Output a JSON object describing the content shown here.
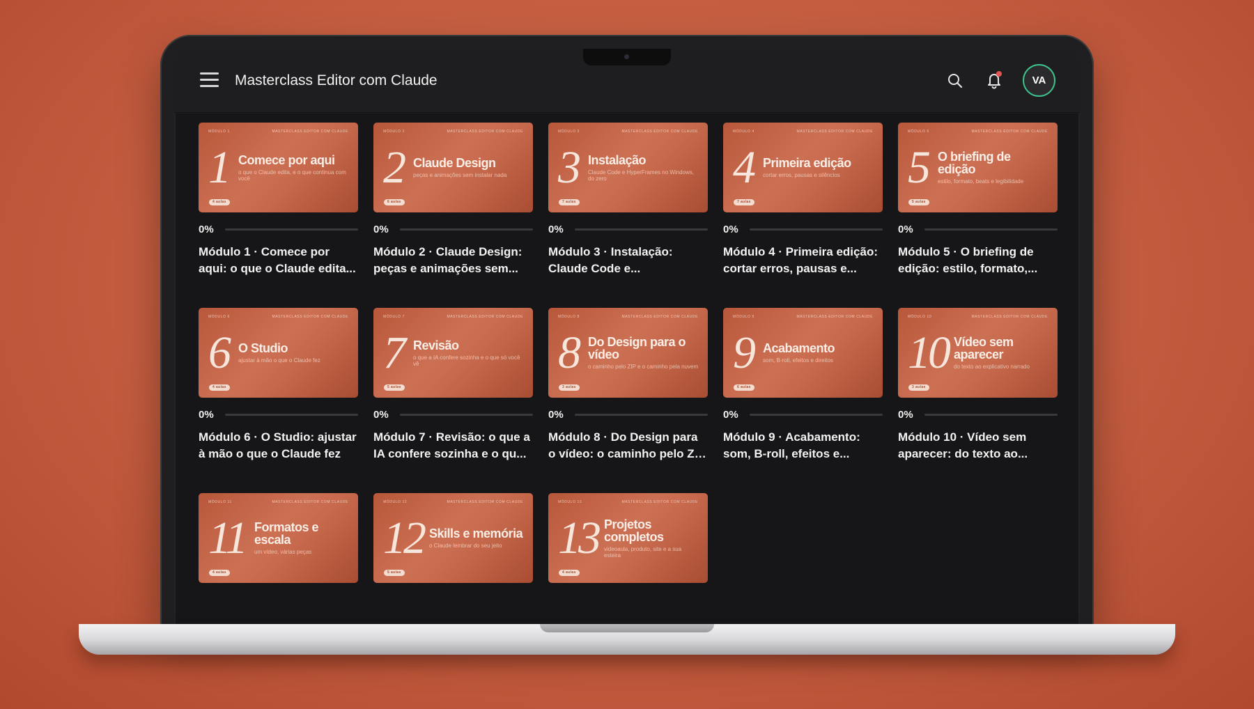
{
  "header": {
    "title": "Masterclass Editor com Claude",
    "avatar_initials": "VA",
    "icons": {
      "menu": "hamburger-icon",
      "search": "search-icon",
      "notifications": "bell-icon"
    },
    "has_unread_notifications": true
  },
  "colors": {
    "accent": "#3ec48f",
    "thumbnail": "#c4633f",
    "notification_dot": "#e55353"
  },
  "modules": [
    {
      "num": "1",
      "kicker": "Módulo 1",
      "brand": "Masterclass Editor com Claude",
      "thumb_title": "Comece por aqui",
      "thumb_sub": "o que o Claude edita, e o que continua com você",
      "badge": "4 aulas",
      "progress_label": "0%",
      "progress": 0,
      "title": "Módulo 1 · Comece por aqui: o que o Claude edita..."
    },
    {
      "num": "2",
      "kicker": "Módulo 2",
      "brand": "Masterclass Editor com Claude",
      "thumb_title": "Claude Design",
      "thumb_sub": "peças e animações sem instalar nada",
      "badge": "6 aulas",
      "progress_label": "0%",
      "progress": 0,
      "title": "Módulo 2 · Claude Design: peças e animações sem..."
    },
    {
      "num": "3",
      "kicker": "Módulo 3",
      "brand": "Masterclass Editor com Claude",
      "thumb_title": "Instalação",
      "thumb_sub": "Claude Code e HyperFrames no Windows, do zero",
      "badge": "7 aulas",
      "progress_label": "0%",
      "progress": 0,
      "title": "Módulo 3 · Instalação: Claude Code e..."
    },
    {
      "num": "4",
      "kicker": "Módulo 4",
      "brand": "Masterclass Editor com Claude",
      "thumb_title": "Primeira edição",
      "thumb_sub": "cortar erros, pausas e silêncios",
      "badge": "7 aulas",
      "progress_label": "0%",
      "progress": 0,
      "title": "Módulo 4 · Primeira edição: cortar erros, pausas e..."
    },
    {
      "num": "5",
      "kicker": "Módulo 5",
      "brand": "Masterclass Editor com Claude",
      "thumb_title": "O briefing de edição",
      "thumb_sub": "estilo, formato, beats e legibilidade",
      "badge": "5 aulas",
      "progress_label": "0%",
      "progress": 0,
      "title": "Módulo 5 · O briefing de edição: estilo, formato,..."
    },
    {
      "num": "6",
      "kicker": "Módulo 6",
      "brand": "Masterclass Editor com Claude",
      "thumb_title": "O Studio",
      "thumb_sub": "ajustar à mão o que o Claude fez",
      "badge": "4 aulas",
      "progress_label": "0%",
      "progress": 0,
      "title": "Módulo 6 · O Studio: ajustar à mão o que o Claude fez"
    },
    {
      "num": "7",
      "kicker": "Módulo 7",
      "brand": "Masterclass Editor com Claude",
      "thumb_title": "Revisão",
      "thumb_sub": "o que a IA confere sozinha e o que só você vê",
      "badge": "5 aulas",
      "progress_label": "0%",
      "progress": 0,
      "title": "Módulo 7 · Revisão: o que a IA confere sozinha e o qu..."
    },
    {
      "num": "8",
      "kicker": "Módulo 8",
      "brand": "Masterclass Editor com Claude",
      "thumb_title": "Do Design para o vídeo",
      "thumb_sub": "o caminho pelo ZIP e o caminho pela nuvem",
      "badge": "3 aulas",
      "progress_label": "0%",
      "progress": 0,
      "title": "Módulo 8 · Do Design para o vídeo: o caminho pelo ZIP ..."
    },
    {
      "num": "9",
      "kicker": "Módulo 9",
      "brand": "Masterclass Editor com Claude",
      "thumb_title": "Acabamento",
      "thumb_sub": "som, B-roll, efeitos e direitos",
      "badge": "6 aulas",
      "progress_label": "0%",
      "progress": 0,
      "title": "Módulo 9 · Acabamento: som, B-roll, efeitos e..."
    },
    {
      "num": "10",
      "kicker": "Módulo 10",
      "brand": "Masterclass Editor com Claude",
      "thumb_title": "Vídeo sem aparecer",
      "thumb_sub": "do texto ao explicativo narrado",
      "badge": "3 aulas",
      "progress_label": "0%",
      "progress": 0,
      "title": "Módulo 10 · Vídeo sem aparecer: do texto ao..."
    },
    {
      "num": "11",
      "kicker": "Módulo 11",
      "brand": "Masterclass Editor com Claude",
      "thumb_title": "Formatos e escala",
      "thumb_sub": "um vídeo, várias peças",
      "badge": "4 aulas",
      "progress_label": "",
      "progress": 0,
      "title": ""
    },
    {
      "num": "12",
      "kicker": "Módulo 12",
      "brand": "Masterclass Editor com Claude",
      "thumb_title": "Skills e memória",
      "thumb_sub": "o Claude lembrar do seu jeito",
      "badge": "5 aulas",
      "progress_label": "",
      "progress": 0,
      "title": ""
    },
    {
      "num": "13",
      "kicker": "Módulo 13",
      "brand": "Masterclass Editor com Claude",
      "thumb_title": "Projetos completos",
      "thumb_sub": "videoaula, produto, site e a sua esteira",
      "badge": "4 aulas",
      "progress_label": "",
      "progress": 0,
      "title": ""
    }
  ]
}
